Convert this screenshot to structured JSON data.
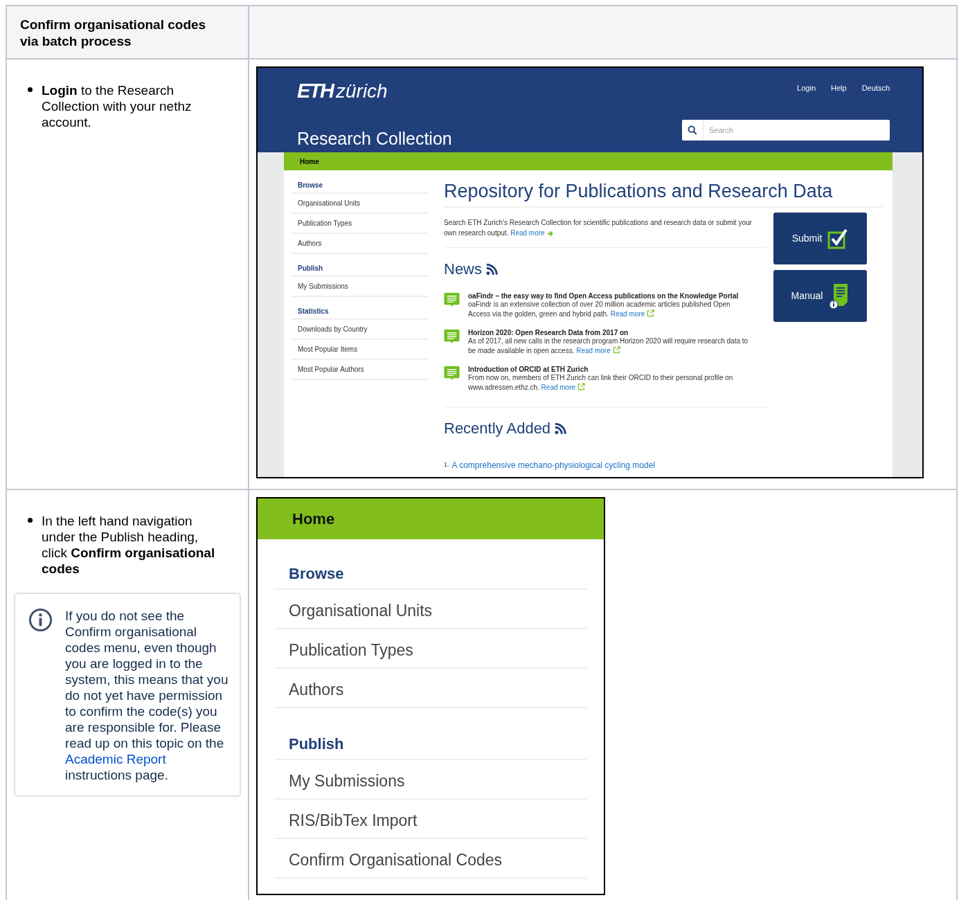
{
  "table": {
    "header": {
      "title": "Confirm organisational codes via batch process"
    },
    "step_login": {
      "text": "**Login** to the Research Collection with your nethz account."
    },
    "screenshot_home": {
      "logo": {
        "bold": "ETH",
        "light": "zürich"
      },
      "top_links": [
        "Login",
        "Help",
        "Deutsch"
      ],
      "site_title": "Research Collection",
      "search": {
        "placeholder": "Search"
      },
      "breadcrumb": "Home",
      "sidebar": [
        {
          "heading": "Browse",
          "items": [
            "Organisational Units",
            "Publication Types",
            "Authors"
          ]
        },
        {
          "heading": "Publish",
          "items": [
            "My Submissions"
          ]
        },
        {
          "heading": "Statistics",
          "items": [
            "Downloads by Country",
            "Most Popular Items",
            "Most Popular Authors"
          ]
        }
      ],
      "heading": "Repository for Publications and Research Data",
      "intro": "Search ETH Zurich's Research Collection for scientific publications and research data or submit your own research output.",
      "intro_link": "Read more",
      "news_heading": "News",
      "news": [
        {
          "title": "oaFindr – the easy way to find Open Access publications on the Knowledge Portal",
          "body": "oaFindr is an extensive collection of over 20 million academic articles published Open Access via the golden, green and hybrid path.",
          "link": "Read more"
        },
        {
          "title": "Horizon 2020: Open Research Data from 2017 on",
          "body": "As of 2017, all new calls in the research program Horizon 2020 will require research data to be made available in open access.",
          "link": "Read more"
        },
        {
          "title": "Introduction of ORCID at ETH Zurich",
          "body": "From now on, members of ETH Zurich can link their ORCID to their personal profile on www.adressen.ethz.ch.",
          "link": "Read more"
        }
      ],
      "buttons": [
        {
          "kind": "submit",
          "label": "Submit"
        },
        {
          "kind": "manual",
          "label": "Manual"
        }
      ],
      "recent_heading": "Recently Added",
      "recent": [
        {
          "number": "1.",
          "title": "A comprehensive mechano-physiological cycling model"
        }
      ]
    },
    "step_navigate": {
      "text": "In the left hand navigation under the Publish heading, click **Confirm organisational codes**"
    },
    "info_panel": {
      "text_before": "If you do not see the Confirm organisational codes menu, even though you are logged in to the system, this means that you do not yet have permission to confirm the code(s) you are responsible for. Please read up on this topic on the",
      "link": "Academic Report",
      "text_after": "instructions page."
    },
    "screenshot_nav": {
      "breadcrumb": "Home",
      "sections": [
        {
          "heading": "Browse",
          "items": [
            "Organisational Units",
            "Publication Types",
            "Authors"
          ]
        },
        {
          "heading": "Publish",
          "items": [
            "My Submissions",
            "RIS/BibTex Import",
            "Confirm Organisational Codes"
          ]
        }
      ]
    }
  }
}
